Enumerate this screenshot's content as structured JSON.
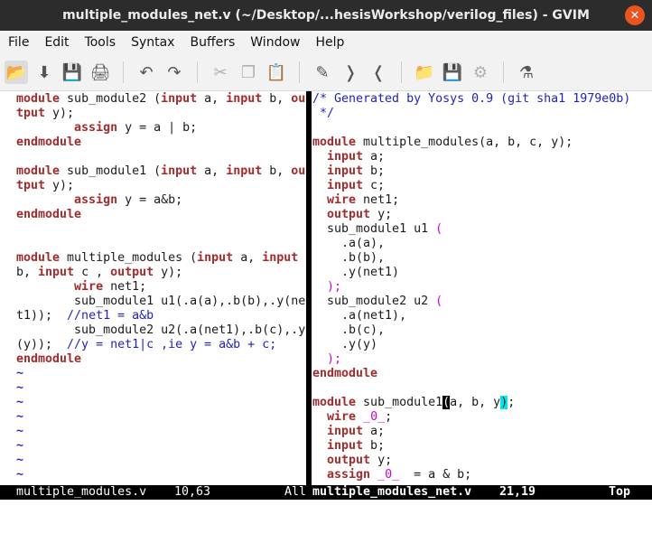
{
  "window": {
    "title": "multiple_modules_net.v (~/Desktop/...hesisWorkshop/verilog_files) - GVIM",
    "close_glyph": "✕"
  },
  "menu": [
    "File",
    "Edit",
    "Tools",
    "Syntax",
    "Buffers",
    "Window",
    "Help"
  ],
  "toolbar": [
    {
      "icon": "open-folder-icon",
      "glyph": "📂",
      "active": true
    },
    {
      "icon": "save-download-icon",
      "glyph": "⬇"
    },
    {
      "icon": "save-all-icon",
      "glyph": "💾"
    },
    {
      "icon": "print-icon",
      "glyph": "🖨"
    },
    {
      "sep": true
    },
    {
      "icon": "undo-icon",
      "glyph": "↶"
    },
    {
      "icon": "redo-icon",
      "glyph": "↷"
    },
    {
      "sep": true
    },
    {
      "icon": "cut-icon",
      "glyph": "✂",
      "disabled": true
    },
    {
      "icon": "copy-icon",
      "glyph": "❐",
      "disabled": true
    },
    {
      "icon": "paste-icon",
      "glyph": "📋"
    },
    {
      "sep": true
    },
    {
      "icon": "find-replace-icon",
      "glyph": "✎"
    },
    {
      "icon": "find-next-icon",
      "glyph": "❭"
    },
    {
      "icon": "find-prev-icon",
      "glyph": "❬"
    },
    {
      "sep": true
    },
    {
      "icon": "load-session-icon",
      "glyph": "📁"
    },
    {
      "icon": "save-session-icon",
      "glyph": "💾"
    },
    {
      "icon": "run-script-icon",
      "glyph": "⚙",
      "disabled": true
    },
    {
      "sep": true
    },
    {
      "icon": "make-icon",
      "glyph": "⚗"
    }
  ],
  "left_pane": {
    "lines": [
      [
        [
          "kw",
          "module"
        ],
        [
          "t",
          " sub_module2 ("
        ],
        [
          "kw",
          "input"
        ],
        [
          "t",
          " a, "
        ],
        [
          "kw",
          "input"
        ],
        [
          "t",
          " b, "
        ],
        [
          "kw",
          "ou"
        ]
      ],
      [
        [
          "kw",
          "tput"
        ],
        [
          "t",
          " y);"
        ]
      ],
      [
        [
          "t",
          "        "
        ],
        [
          "kw",
          "assign"
        ],
        [
          "t",
          " y = a | b;"
        ]
      ],
      [
        [
          "kw",
          "endmodule"
        ]
      ],
      [
        [
          "t",
          ""
        ]
      ],
      [
        [
          "kw",
          "module"
        ],
        [
          "t",
          " sub_module1 ("
        ],
        [
          "kw",
          "input"
        ],
        [
          "t",
          " a, "
        ],
        [
          "kw",
          "input"
        ],
        [
          "t",
          " b, "
        ],
        [
          "kw",
          "ou"
        ]
      ],
      [
        [
          "kw",
          "tput"
        ],
        [
          "t",
          " y);"
        ]
      ],
      [
        [
          "t",
          "        "
        ],
        [
          "kw",
          "assign"
        ],
        [
          "t",
          " y = a&b;"
        ]
      ],
      [
        [
          "kw",
          "endmodule"
        ]
      ],
      [
        [
          "t",
          ""
        ]
      ],
      [
        [
          "t",
          ""
        ]
      ],
      [
        [
          "kw",
          "module"
        ],
        [
          "t",
          " multiple_modules ("
        ],
        [
          "kw",
          "input"
        ],
        [
          "t",
          " a, "
        ],
        [
          "kw",
          "input"
        ]
      ],
      [
        [
          "t",
          "b, "
        ],
        [
          "kw",
          "input"
        ],
        [
          "t",
          " c , "
        ],
        [
          "kw",
          "output"
        ],
        [
          "t",
          " y);"
        ]
      ],
      [
        [
          "t",
          "        "
        ],
        [
          "kw",
          "wire"
        ],
        [
          "t",
          " net1;"
        ]
      ],
      [
        [
          "t",
          "        sub_module1 u1(.a(a),.b(b),.y(ne"
        ]
      ],
      [
        [
          "t",
          "t1));  "
        ],
        [
          "cm",
          "//net1 = a&b"
        ]
      ],
      [
        [
          "t",
          "        sub_module2 u2(.a(net1),.b(c),.y"
        ]
      ],
      [
        [
          "t",
          "(y));  "
        ],
        [
          "cm",
          "//y = net1|c ,ie y = a&b + c;"
        ]
      ],
      [
        [
          "kw",
          "endmodule"
        ]
      ],
      [
        [
          "tilde",
          "~"
        ]
      ],
      [
        [
          "tilde",
          "~"
        ]
      ],
      [
        [
          "tilde",
          "~"
        ]
      ],
      [
        [
          "tilde",
          "~"
        ]
      ],
      [
        [
          "tilde",
          "~"
        ]
      ],
      [
        [
          "tilde",
          "~"
        ]
      ],
      [
        [
          "tilde",
          "~"
        ]
      ],
      [
        [
          "tilde",
          "~"
        ]
      ]
    ]
  },
  "right_pane": {
    "lines": [
      [
        [
          "cm",
          "/* Generated by Yosys 0.9 (git sha1 1979e0b)"
        ]
      ],
      [
        [
          "cm",
          " */"
        ]
      ],
      [
        [
          "t",
          ""
        ]
      ],
      [
        [
          "kw",
          "module"
        ],
        [
          "t",
          " multiple_modules(a, b, c, y);"
        ]
      ],
      [
        [
          "t",
          "  "
        ],
        [
          "kw",
          "input"
        ],
        [
          "t",
          " a;"
        ]
      ],
      [
        [
          "t",
          "  "
        ],
        [
          "kw",
          "input"
        ],
        [
          "t",
          " b;"
        ]
      ],
      [
        [
          "t",
          "  "
        ],
        [
          "kw",
          "input"
        ],
        [
          "t",
          " c;"
        ]
      ],
      [
        [
          "t",
          "  "
        ],
        [
          "kw",
          "wire"
        ],
        [
          "t",
          " net1;"
        ]
      ],
      [
        [
          "t",
          "  "
        ],
        [
          "kw",
          "output"
        ],
        [
          "t",
          " y;"
        ]
      ],
      [
        [
          "t",
          "  sub_module1 u1 "
        ],
        [
          "pu",
          "("
        ]
      ],
      [
        [
          "t",
          "    .a(a),"
        ]
      ],
      [
        [
          "t",
          "    .b(b),"
        ]
      ],
      [
        [
          "t",
          "    .y(net1)"
        ]
      ],
      [
        [
          "t",
          "  "
        ],
        [
          "pu",
          ");"
        ]
      ],
      [
        [
          "t",
          "  sub_module2 u2 "
        ],
        [
          "pu",
          "("
        ]
      ],
      [
        [
          "t",
          "    .a(net1),"
        ]
      ],
      [
        [
          "t",
          "    .b(c),"
        ]
      ],
      [
        [
          "t",
          "    .y(y)"
        ]
      ],
      [
        [
          "t",
          "  "
        ],
        [
          "pu",
          ");"
        ]
      ],
      [
        [
          "kw",
          "endmodule"
        ]
      ],
      [
        [
          "t",
          ""
        ]
      ],
      [
        [
          "kw",
          "module"
        ],
        [
          "t",
          " sub_module1"
        ],
        [
          "cur",
          "("
        ],
        [
          "t",
          "a, b, y"
        ],
        [
          "hl",
          ")"
        ],
        [
          "t",
          ";"
        ]
      ],
      [
        [
          "t",
          "  "
        ],
        [
          "kw",
          "wire"
        ],
        [
          "t",
          " "
        ],
        [
          "pu",
          "_0_"
        ],
        [
          "t",
          ";"
        ]
      ],
      [
        [
          "t",
          "  "
        ],
        [
          "kw",
          "input"
        ],
        [
          "t",
          " a;"
        ]
      ],
      [
        [
          "t",
          "  "
        ],
        [
          "kw",
          "input"
        ],
        [
          "t",
          " b;"
        ]
      ],
      [
        [
          "t",
          "  "
        ],
        [
          "kw",
          "output"
        ],
        [
          "t",
          " y;"
        ]
      ],
      [
        [
          "t",
          "  "
        ],
        [
          "kw",
          "assign"
        ],
        [
          "t",
          " "
        ],
        [
          "pu",
          "_0_"
        ],
        [
          "t",
          "  = a & b;"
        ]
      ]
    ]
  },
  "status": {
    "left_file": "multiple_modules.v",
    "left_pos": "10,63",
    "left_pct": "All",
    "right_file": "multiple_modules_net.v",
    "right_pos": "21,19",
    "right_pct": "Top"
  }
}
